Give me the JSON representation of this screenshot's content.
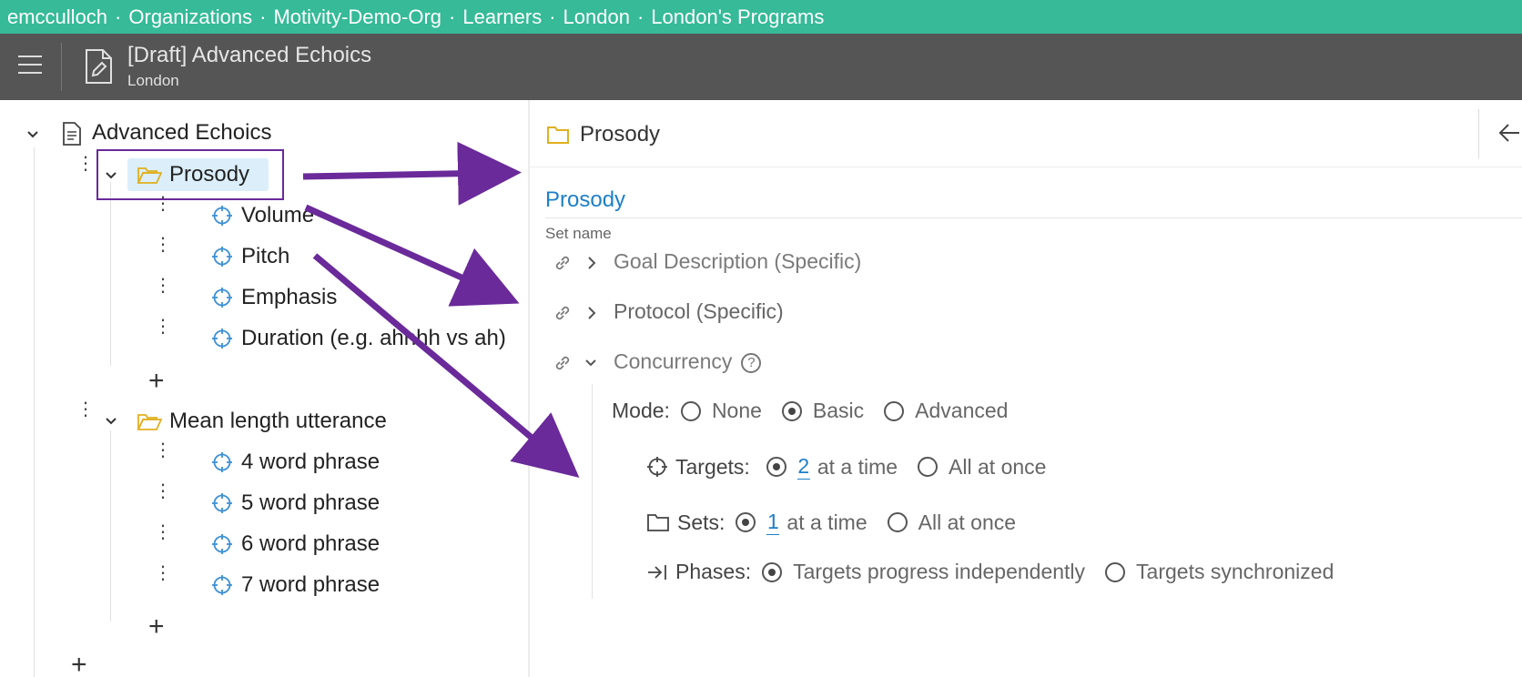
{
  "breadcrumb": [
    "emcculloch",
    "Organizations",
    "Motivity-Demo-Org",
    "Learners",
    "London",
    "London's Programs"
  ],
  "header": {
    "title": "[Draft] Advanced Echoics",
    "subtitle": "London"
  },
  "tree": {
    "root_label": "Advanced Echoics",
    "folders": [
      {
        "label": "Prosody",
        "selected": true,
        "targets": [
          "Volume",
          "Pitch",
          "Emphasis",
          "Duration (e.g. ahhhh vs ah)"
        ]
      },
      {
        "label": "Mean length utterance",
        "selected": false,
        "targets": [
          "4 word phrase",
          "5 word phrase",
          "6 word phrase",
          "7 word phrase"
        ]
      }
    ]
  },
  "detail": {
    "header_title": "Prosody",
    "set_name_value": "Prosody",
    "set_name_label": "Set name",
    "sections": {
      "goal": "Goal Description (Specific)",
      "protocol": "Protocol (Specific)",
      "concurrency": "Concurrency"
    },
    "help_glyph": "?",
    "mode": {
      "label": "Mode:",
      "options": [
        "None",
        "Basic",
        "Advanced"
      ],
      "selected": "Basic"
    },
    "targets": {
      "label": "Targets:",
      "count": "2",
      "at_a_time": "at a time",
      "all_at_once": "All at once",
      "selected": "count"
    },
    "sets": {
      "label": "Sets:",
      "count": "1",
      "at_a_time": "at a time",
      "all_at_once": "All at once",
      "selected": "count"
    },
    "phases": {
      "label": "Phases:",
      "options": [
        "Targets progress independently",
        "Targets synchronized"
      ],
      "selected": "Targets progress independently"
    }
  },
  "colors": {
    "breadcrumb_bg": "#36ba98",
    "header_bg": "#555555",
    "accent_blue": "#1d7fc8",
    "folder_yellow": "#e0b020",
    "annotation_purple": "#6a2a9a",
    "selection_bg": "#dbeefa"
  }
}
